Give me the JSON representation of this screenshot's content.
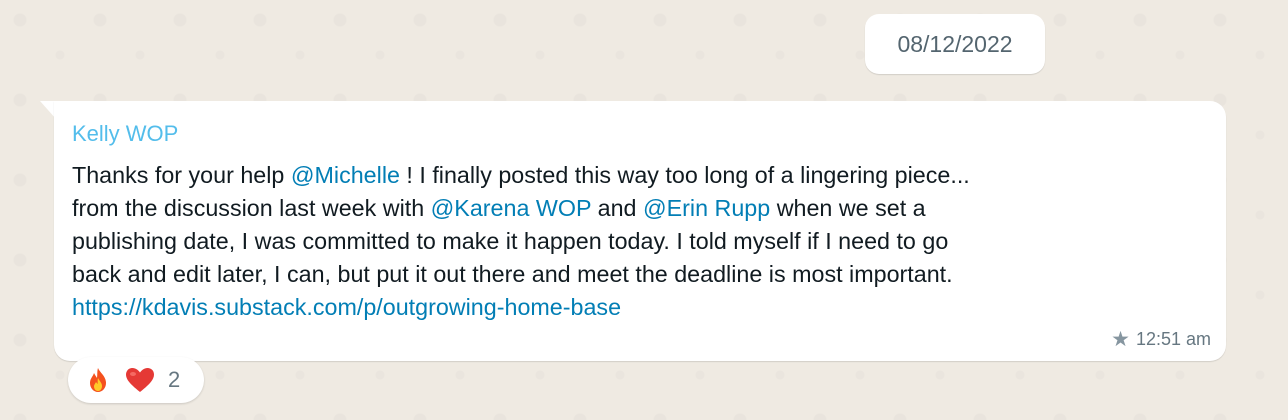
{
  "date_chip": "08/12/2022",
  "message": {
    "sender": "Kelly WOP",
    "line1": {
      "pre": "Thanks for your help ",
      "mention": "@Michelle",
      "post": " ! I finally posted this way too long of a lingering piece..."
    },
    "line2": {
      "pre": "from the discussion last week with ",
      "mention1": "@Karena WOP",
      "mid": " and ",
      "mention2": "@Erin Rupp",
      "post": " when we set a"
    },
    "line3": "publishing date, I was committed to make it happen today. I told myself if I need to go",
    "line4": "back and edit later, I can, but put it out there and meet the deadline is most important.",
    "link": "https://kdavis.substack.com/p/outgrowing-home-base",
    "time": "12:51 am",
    "starred_icon": "star-icon"
  },
  "reactions": {
    "emojis": [
      "fire-emoji",
      "red-heart-emoji"
    ],
    "count": "2"
  },
  "colors": {
    "background": "#efeae2",
    "bubble": "#ffffff",
    "sender": "#53bdeb",
    "mention": "#027eb5",
    "text": "#111b21",
    "meta": "#667781"
  }
}
